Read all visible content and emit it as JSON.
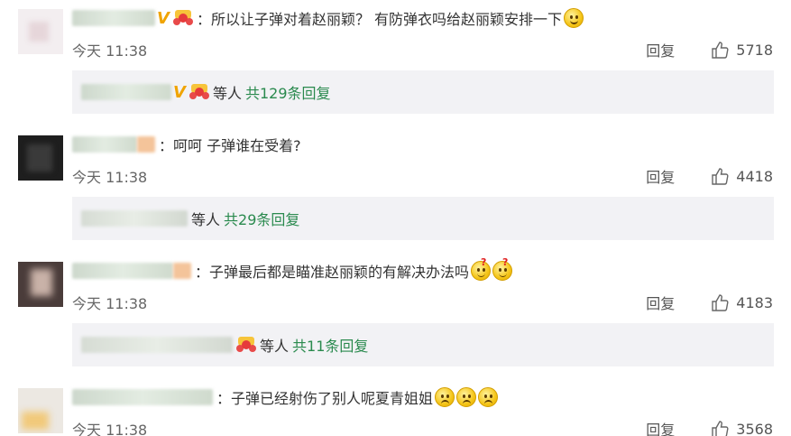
{
  "comments": [
    {
      "text": "所以让子弹对着赵丽颖？ 有防弹衣吗给赵丽颖安排一下",
      "time": "今天 11:38",
      "reply_label": "回复",
      "likes": "5718",
      "sub": {
        "who": "等人",
        "count": "共129条回复"
      }
    },
    {
      "text": "呵呵 子弹谁在受着?",
      "time": "今天 11:38",
      "reply_label": "回复",
      "likes": "4418",
      "sub": {
        "who": "等人",
        "count": "共29条回复"
      }
    },
    {
      "text": "子弹最后都是瞄准赵丽颖的有解决办法吗",
      "time": "今天 11:38",
      "reply_label": "回复",
      "likes": "4183",
      "sub": {
        "who": "等人",
        "count": "共11条回复"
      }
    },
    {
      "text": "子弹已经射伤了别人呢夏青姐姐",
      "time": "今天 11:38",
      "reply_label": "回复",
      "likes": "3568"
    }
  ],
  "badge_v": "V",
  "colors": {
    "reply_count": "#2a8a4e",
    "sub_bg": "#f2f2f5"
  }
}
